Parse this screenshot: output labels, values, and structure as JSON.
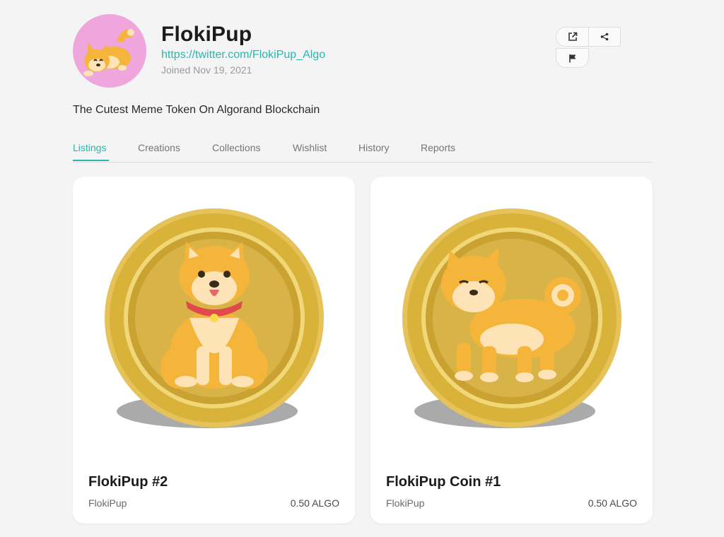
{
  "profile": {
    "name": "FlokiPup",
    "link": "https://twitter.com/FlokiPup_Algo",
    "joined": "Joined Nov 19, 2021",
    "bio": "The Cutest Meme Token On Algorand Blockchain"
  },
  "actions": {
    "open_icon": "external-link-icon",
    "share_icon": "share-icon",
    "flag_icon": "flag-icon"
  },
  "tabs": [
    {
      "label": "Listings",
      "active": true
    },
    {
      "label": "Creations",
      "active": false
    },
    {
      "label": "Collections",
      "active": false
    },
    {
      "label": "Wishlist",
      "active": false
    },
    {
      "label": "History",
      "active": false
    },
    {
      "label": "Reports",
      "active": false
    }
  ],
  "listings": [
    {
      "title": "FlokiPup #2",
      "creator": "FlokiPup",
      "price": "0.50 ALGO"
    },
    {
      "title": "FlokiPup Coin #1",
      "creator": "FlokiPup",
      "price": "0.50 ALGO"
    }
  ],
  "colors": {
    "accent": "#26b7ae",
    "avatar_bg": "#efa6dc",
    "coin_gold": "#d9b23a",
    "dog_orange": "#f5b53a"
  }
}
